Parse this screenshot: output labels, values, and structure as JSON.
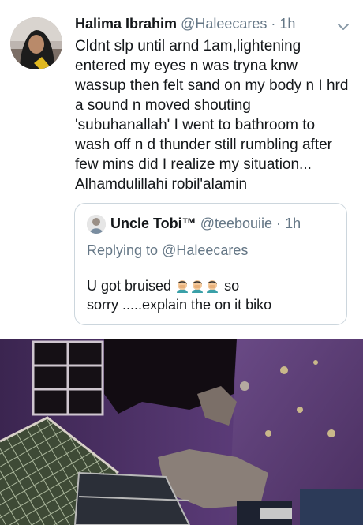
{
  "tweet": {
    "author_name": "Halima Ibrahim",
    "handle": "@Haleecares",
    "separator": "·",
    "time": "1h",
    "text_lines": [
      "Cldnt slp until arnd 1am,lightening",
      "entered my eyes n was tryna knw",
      "wassup then felt sand on my body n I hrd",
      "a sound n moved shouting",
      "'subuhanallah' I went to bathroom to",
      "wash off n d thunder still rumbling after",
      "few mins did I realize my situation...",
      "Alhamdulillahi robil'alamin"
    ]
  },
  "quoted_tweet": {
    "author_name": "Uncle Tobi™",
    "handle": "@teebouiie",
    "separator": "·",
    "time": "1h",
    "replying_prefix": "Replying to",
    "replying_to": "@Haleecares",
    "line1": "U got bruised",
    "line1_suffix": "so",
    "line2": "sorry .....explain the on it biko",
    "emoji_count": 3
  },
  "icons": {
    "menu": "chevron-down-icon",
    "emoji": "man-facepalming-emoji-icon"
  },
  "colors": {
    "text": "#14171a",
    "secondary": "#657786",
    "border": "#ccd6dd",
    "wall_purple": "#5a3a74"
  }
}
